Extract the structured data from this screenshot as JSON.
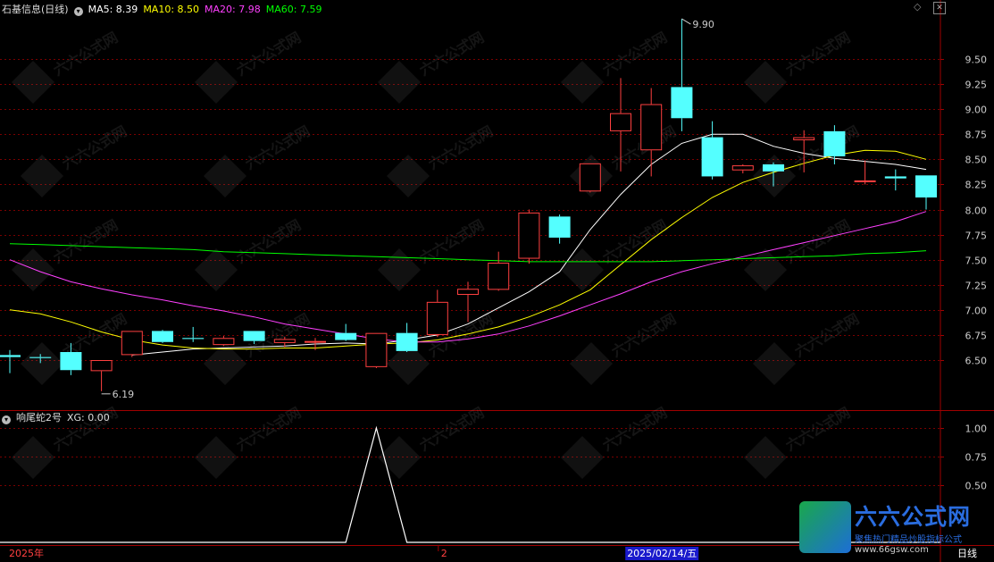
{
  "header": {
    "stock_name": "石基信息(日线)",
    "ma5": "MA5: 8.39",
    "ma10": "MA10: 8.50",
    "ma20": "MA20: 7.98",
    "ma60": "MA60: 7.59",
    "colors": {
      "ma5": "#ffffff",
      "ma10": "#ffff00",
      "ma20": "#ff40ff",
      "ma60": "#00ff00"
    }
  },
  "indicator": {
    "name": "响尾蛇2号",
    "xg": "XG: 0.00",
    "y_ticks": [
      "1.00",
      "0.75",
      "0.50"
    ]
  },
  "x_axis": {
    "labels": [
      "2025年",
      "2",
      "2025/02/14/五",
      "日线"
    ]
  },
  "price_axis": {
    "ticks": [
      "9.50",
      "9.25",
      "9.00",
      "8.75",
      "8.50",
      "8.25",
      "8.00",
      "7.75",
      "7.50",
      "7.25",
      "7.00",
      "6.75",
      "6.50"
    ]
  },
  "annotations": {
    "high": "9.90",
    "low": "6.19"
  },
  "watermark": {
    "title": "六六公式网",
    "slogan": "聚焦热门精品炒股指标公式",
    "url": "www.66gsw.com"
  },
  "chart_data": [
    {
      "type": "candlestick",
      "title": "石基信息(日线)",
      "ylim": [
        6.15,
        9.95
      ],
      "up_color": "#ff4040",
      "down_color": "#54ffff",
      "candles": [
        {
          "o": 6.55,
          "h": 6.6,
          "l": 6.37,
          "c": 6.53
        },
        {
          "o": 6.53,
          "h": 6.56,
          "l": 6.47,
          "c": 6.52
        },
        {
          "o": 6.58,
          "h": 6.67,
          "l": 6.35,
          "c": 6.4
        },
        {
          "o": 6.39,
          "h": 6.5,
          "l": 6.19,
          "c": 6.5
        },
        {
          "o": 6.55,
          "h": 6.79,
          "l": 6.53,
          "c": 6.79
        },
        {
          "o": 6.79,
          "h": 6.8,
          "l": 6.67,
          "c": 6.68
        },
        {
          "o": 6.72,
          "h": 6.83,
          "l": 6.68,
          "c": 6.71
        },
        {
          "o": 6.65,
          "h": 6.74,
          "l": 6.64,
          "c": 6.72
        },
        {
          "o": 6.79,
          "h": 6.79,
          "l": 6.66,
          "c": 6.69
        },
        {
          "o": 6.67,
          "h": 6.73,
          "l": 6.63,
          "c": 6.71
        },
        {
          "o": 6.68,
          "h": 6.72,
          "l": 6.6,
          "c": 6.69
        },
        {
          "o": 6.77,
          "h": 6.86,
          "l": 6.69,
          "c": 6.7
        },
        {
          "o": 6.43,
          "h": 6.77,
          "l": 6.42,
          "c": 6.77
        },
        {
          "o": 6.77,
          "h": 6.87,
          "l": 6.58,
          "c": 6.59
        },
        {
          "o": 6.75,
          "h": 7.2,
          "l": 6.73,
          "c": 7.08
        },
        {
          "o": 7.15,
          "h": 7.28,
          "l": 6.88,
          "c": 7.21
        },
        {
          "o": 7.2,
          "h": 7.58,
          "l": 7.19,
          "c": 7.47
        },
        {
          "o": 7.51,
          "h": 8.0,
          "l": 7.46,
          "c": 7.97
        },
        {
          "o": 7.93,
          "h": 7.95,
          "l": 7.66,
          "c": 7.72
        },
        {
          "o": 8.18,
          "h": 8.46,
          "l": 8.17,
          "c": 8.46
        },
        {
          "o": 8.78,
          "h": 9.31,
          "l": 8.38,
          "c": 8.96
        },
        {
          "o": 8.59,
          "h": 9.21,
          "l": 8.33,
          "c": 9.05
        },
        {
          "o": 9.22,
          "h": 9.9,
          "l": 8.78,
          "c": 8.91
        },
        {
          "o": 8.72,
          "h": 8.88,
          "l": 8.3,
          "c": 8.33
        },
        {
          "o": 8.39,
          "h": 8.45,
          "l": 8.36,
          "c": 8.44
        },
        {
          "o": 8.45,
          "h": 8.47,
          "l": 8.23,
          "c": 8.38
        },
        {
          "o": 8.69,
          "h": 8.79,
          "l": 8.37,
          "c": 8.72
        },
        {
          "o": 8.78,
          "h": 8.84,
          "l": 8.45,
          "c": 8.53
        },
        {
          "o": 8.28,
          "h": 8.49,
          "l": 8.25,
          "c": 8.29
        },
        {
          "o": 8.33,
          "h": 8.4,
          "l": 8.19,
          "c": 8.31
        },
        {
          "o": 8.34,
          "h": 8.34,
          "l": 8.0,
          "c": 8.12
        }
      ],
      "series": [
        {
          "name": "MA5",
          "values": [
            null,
            null,
            null,
            null,
            6.55,
            6.58,
            6.61,
            6.62,
            6.63,
            6.64,
            6.66,
            6.67,
            6.66,
            6.7,
            6.75,
            6.86,
            7.02,
            7.18,
            7.38,
            7.8,
            8.15,
            8.45,
            8.66,
            8.75,
            8.75,
            8.63,
            8.56,
            8.51,
            8.48,
            8.45,
            8.4
          ]
        },
        {
          "name": "MA10",
          "values": [
            7.0,
            6.96,
            6.88,
            6.78,
            6.7,
            6.65,
            6.62,
            6.61,
            6.61,
            6.62,
            6.62,
            6.64,
            6.66,
            6.67,
            6.7,
            6.76,
            6.83,
            6.93,
            7.05,
            7.2,
            7.45,
            7.7,
            7.92,
            8.12,
            8.27,
            8.37,
            8.46,
            8.54,
            8.59,
            8.58,
            8.5
          ]
        },
        {
          "name": "MA20",
          "values": [
            7.5,
            7.38,
            7.28,
            7.21,
            7.15,
            7.1,
            7.04,
            6.99,
            6.93,
            6.86,
            6.81,
            6.76,
            6.71,
            6.68,
            6.68,
            6.71,
            6.76,
            6.84,
            6.94,
            7.05,
            7.16,
            7.28,
            7.38,
            7.46,
            7.53,
            7.6,
            7.67,
            7.74,
            7.81,
            7.88,
            7.98
          ]
        },
        {
          "name": "MA60",
          "values": [
            7.66,
            7.65,
            7.64,
            7.63,
            7.62,
            7.61,
            7.6,
            7.58,
            7.57,
            7.56,
            7.55,
            7.54,
            7.53,
            7.52,
            7.51,
            7.5,
            7.49,
            7.48,
            7.48,
            7.48,
            7.48,
            7.48,
            7.49,
            7.5,
            7.51,
            7.52,
            7.53,
            7.54,
            7.56,
            7.57,
            7.59
          ]
        }
      ]
    },
    {
      "type": "line",
      "title": "响尾蛇2号",
      "ylim": [
        0,
        1.0
      ],
      "series": [
        {
          "name": "XG",
          "values": [
            0,
            0,
            0,
            0,
            0,
            0,
            0,
            0,
            0,
            0,
            0,
            0,
            1,
            0,
            0,
            0,
            0,
            0,
            0,
            0,
            0,
            0,
            0,
            0,
            0,
            0,
            0,
            0,
            0,
            0,
            0
          ]
        }
      ]
    }
  ]
}
